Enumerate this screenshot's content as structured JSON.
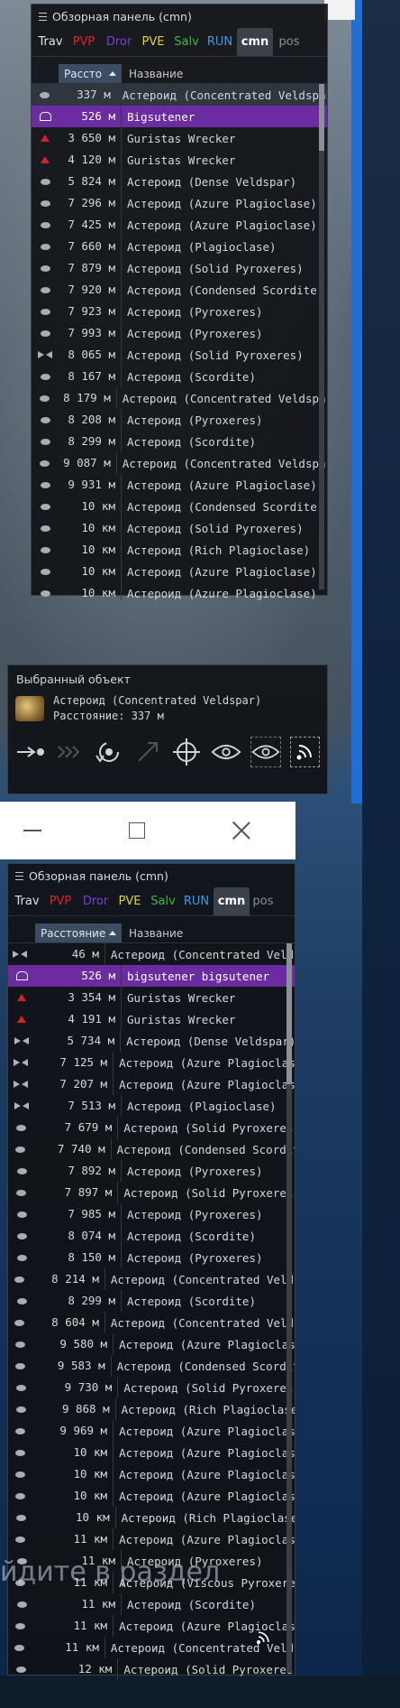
{
  "colors": {
    "tab_trav": "#e0e0e0",
    "tab_pvp": "#d9262c",
    "tab_dror": "#7a3fd1",
    "tab_pve": "#e2d23a",
    "tab_salv": "#3fb54b",
    "tab_run": "#3c9be8",
    "tab_cmn": "#ffffff",
    "tab_pos": "#8c8f93",
    "selected_row": "#6a2ca0"
  },
  "panel1": {
    "title": "Обзорная панель (cmn)",
    "tabs": [
      "Trav",
      "PVP",
      "Dror",
      "PVE",
      "Salv",
      "RUN",
      "cmn",
      "pos"
    ],
    "col_distance": "Рассто",
    "col_name": "Название",
    "rows": [
      {
        "icon": "asteroid-icon",
        "dist": "337 м",
        "name": "Астероид (Concentrated Veldspar)"
      },
      {
        "icon": "ship-icon",
        "dist": "526 м",
        "name": "Bigsutener"
      },
      {
        "icon": "wreck-icon",
        "dist": "3 650 м",
        "name": "Guristas Wrecker"
      },
      {
        "icon": "wreck-icon",
        "dist": "4 120 м",
        "name": "Guristas Wrecker"
      },
      {
        "icon": "asteroid-icon",
        "dist": "5 824 м",
        "name": "Астероид (Dense Veldspar)"
      },
      {
        "icon": "asteroid-icon",
        "dist": "7 296 м",
        "name": "Астероид (Azure Plagioclase)"
      },
      {
        "icon": "asteroid-icon",
        "dist": "7 425 м",
        "name": "Астероид (Azure Plagioclase)"
      },
      {
        "icon": "asteroid-icon",
        "dist": "7 660 м",
        "name": "Астероид (Plagioclase)"
      },
      {
        "icon": "asteroid-icon",
        "dist": "7 879 м",
        "name": "Астероид (Solid Pyroxeres)"
      },
      {
        "icon": "asteroid-icon",
        "dist": "7 920 м",
        "name": "Астероид (Condensed Scordite)"
      },
      {
        "icon": "asteroid-icon",
        "dist": "7 923 м",
        "name": "Астероид (Pyroxeres)"
      },
      {
        "icon": "asteroid-icon",
        "dist": "7 993 м",
        "name": "Астероид (Pyroxeres)"
      },
      {
        "icon": "bowtie-icon",
        "dist": "8 065 м",
        "name": "Астероид (Solid Pyroxeres)"
      },
      {
        "icon": "asteroid-icon",
        "dist": "8 167 м",
        "name": "Астероид (Scordite)"
      },
      {
        "icon": "asteroid-icon",
        "dist": "8 179 м",
        "name": "Астероид (Concentrated Veldspar)"
      },
      {
        "icon": "asteroid-icon",
        "dist": "8 208 м",
        "name": "Астероид (Pyroxeres)"
      },
      {
        "icon": "asteroid-icon",
        "dist": "8 299 м",
        "name": "Астероид (Scordite)"
      },
      {
        "icon": "asteroid-icon",
        "dist": "9 087 м",
        "name": "Астероид (Concentrated Veldspar)"
      },
      {
        "icon": "asteroid-icon",
        "dist": "9 931 м",
        "name": "Астероид (Azure Plagioclase)"
      },
      {
        "icon": "asteroid-icon",
        "dist": "10 км",
        "name": "Астероид (Condensed Scordite)"
      },
      {
        "icon": "asteroid-icon",
        "dist": "10 км",
        "name": "Астероид (Solid Pyroxeres)"
      },
      {
        "icon": "asteroid-icon",
        "dist": "10 км",
        "name": "Астероид (Rich Plagioclase)"
      },
      {
        "icon": "asteroid-icon",
        "dist": "10 км",
        "name": "Астероид (Azure Plagioclase)"
      },
      {
        "icon": "asteroid-icon",
        "dist": "10 км",
        "name": "Астероид (Azure Plagioclase)"
      }
    ]
  },
  "selected": {
    "title": "Выбранный объект",
    "name": "Астероид (Concentrated Veldspar)",
    "distance": "Расстояние: 337 м"
  },
  "panel2": {
    "title": "Обзорная панель (cmn)",
    "tabs": [
      "Trav",
      "PVP",
      "Dror",
      "PVE",
      "Salv",
      "RUN",
      "cmn",
      "pos"
    ],
    "col_distance": "Расстояние",
    "col_name": "Название",
    "rows": [
      {
        "icon": "bowtie-icon",
        "dist": "46 м",
        "name": "Астероид (Concentrated Veldspar)"
      },
      {
        "icon": "ship-icon",
        "dist": "526 м",
        "name": "bigsutener bigsutener"
      },
      {
        "icon": "wreck-icon",
        "dist": "3 354 м",
        "name": "Guristas Wrecker"
      },
      {
        "icon": "wreck-icon",
        "dist": "4 191 м",
        "name": "Guristas Wrecker"
      },
      {
        "icon": "bowtie-icon",
        "dist": "5 734 м",
        "name": "Астероид (Dense Veldspar)"
      },
      {
        "icon": "bowtie-icon",
        "dist": "7 125 м",
        "name": "Астероид (Azure Plagioclase)"
      },
      {
        "icon": "bowtie-icon",
        "dist": "7 207 м",
        "name": "Астероид (Azure Plagioclase)"
      },
      {
        "icon": "bowtie-icon",
        "dist": "7 513 м",
        "name": "Астероид (Plagioclase)"
      },
      {
        "icon": "asteroid-icon",
        "dist": "7 679 м",
        "name": "Астероид (Solid Pyroxeres)"
      },
      {
        "icon": "asteroid-icon",
        "dist": "7 740 м",
        "name": "Астероид (Condensed Scordite)"
      },
      {
        "icon": "asteroid-icon",
        "dist": "7 892 м",
        "name": "Астероид (Pyroxeres)"
      },
      {
        "icon": "asteroid-icon",
        "dist": "7 897 м",
        "name": "Астероид (Solid Pyroxeres)"
      },
      {
        "icon": "asteroid-icon",
        "dist": "7 985 м",
        "name": "Астероид (Pyroxeres)"
      },
      {
        "icon": "asteroid-icon",
        "dist": "8 074 м",
        "name": "Астероид (Scordite)"
      },
      {
        "icon": "asteroid-icon",
        "dist": "8 150 м",
        "name": "Астероид (Pyroxeres)"
      },
      {
        "icon": "asteroid-icon",
        "dist": "8 214 м",
        "name": "Астероид (Concentrated Veldspar)"
      },
      {
        "icon": "asteroid-icon",
        "dist": "8 299 м",
        "name": "Астероид (Scordite)"
      },
      {
        "icon": "asteroid-icon",
        "dist": "8 604 м",
        "name": "Астероид (Concentrated Veldspar)"
      },
      {
        "icon": "asteroid-icon",
        "dist": "9 580 м",
        "name": "Астероид (Azure Plagioclase)"
      },
      {
        "icon": "asteroid-icon",
        "dist": "9 583 м",
        "name": "Астероид (Condensed Scordite)"
      },
      {
        "icon": "asteroid-icon",
        "dist": "9 730 м",
        "name": "Астероид (Solid Pyroxeres)"
      },
      {
        "icon": "asteroid-icon",
        "dist": "9 868 м",
        "name": "Астероид (Rich Plagioclase)"
      },
      {
        "icon": "asteroid-icon",
        "dist": "9 969 м",
        "name": "Астероид (Azure Plagioclase)"
      },
      {
        "icon": "asteroid-icon",
        "dist": "10 км",
        "name": "Астероид (Azure Plagioclase)"
      },
      {
        "icon": "asteroid-icon",
        "dist": "10 км",
        "name": "Астероид (Azure Plagioclase)"
      },
      {
        "icon": "asteroid-icon",
        "dist": "10 км",
        "name": "Астероид (Azure Plagioclase)"
      },
      {
        "icon": "asteroid-icon",
        "dist": "10 км",
        "name": "Астероид (Rich Plagioclase)"
      },
      {
        "icon": "asteroid-icon",
        "dist": "11 км",
        "name": "Астероид (Azure Plagioclase)"
      },
      {
        "icon": "asteroid-icon",
        "dist": "11 км",
        "name": "Астероид (Pyroxeres)"
      },
      {
        "icon": "asteroid-icon",
        "dist": "11 км",
        "name": "Астероид (Viscous Pyroxeres)"
      },
      {
        "icon": "asteroid-icon",
        "dist": "11 км",
        "name": "Астероид (Scordite)"
      },
      {
        "icon": "asteroid-icon",
        "dist": "11 км",
        "name": "Астероид (Azure Plagioclase)"
      },
      {
        "icon": "asteroid-icon",
        "dist": "11 км",
        "name": "Астероид (Concentrated Veldspar)"
      },
      {
        "icon": "asteroid-icon",
        "dist": "12 км",
        "name": "Астероид (Solid Pyroxeres)"
      }
    ]
  },
  "overlay_text": "йдите в раздел"
}
